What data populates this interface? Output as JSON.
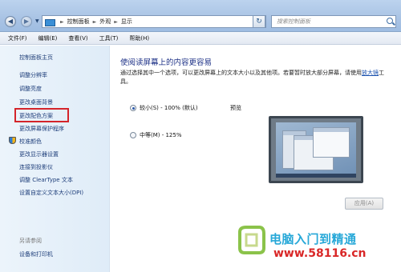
{
  "address_bar": {
    "crumbs": [
      "控制面板",
      "外观",
      "显示"
    ],
    "search_placeholder": "搜索控制面板"
  },
  "menu": [
    "文件(F)",
    "编辑(E)",
    "查看(V)",
    "工具(T)",
    "帮助(H)"
  ],
  "sidebar": {
    "home": "控制面板主页",
    "links": [
      "调整分辨率",
      "调整亮度",
      "更改桌面背景",
      "更改配色方案",
      "更改屏幕保护程序",
      "校准颜色",
      "更改显示器设置",
      "连接到投影仪",
      "调整 ClearType 文本",
      "设置自定义文本大小(DPI)"
    ],
    "see_also_title": "另请参阅",
    "see_also_links": [
      "设备和打印机"
    ]
  },
  "main": {
    "heading": "使阅读屏幕上的内容更容易",
    "desc_text": "通过选择其中一个选项，可以更改屏幕上的文本大小以及其他项。若要暂时放大部分屏幕，请使用",
    "desc_link": "放大镜",
    "desc_suffix": "工具。",
    "options": [
      {
        "label": "较小(S) - 100% (默认)",
        "selected": true
      },
      {
        "label": "中等(M) - 125%",
        "selected": false
      }
    ],
    "preview_label": "预览",
    "apply_button": "应用(A)"
  },
  "watermark": {
    "title": "电脑入门到精通",
    "url": "www.58116.cn"
  },
  "colors": {
    "heading": "#1e3287",
    "link": "#1e3e7a",
    "highlight_box": "#d4242a",
    "watermark_title": "#27a8d8",
    "watermark_url": "#d92727"
  }
}
